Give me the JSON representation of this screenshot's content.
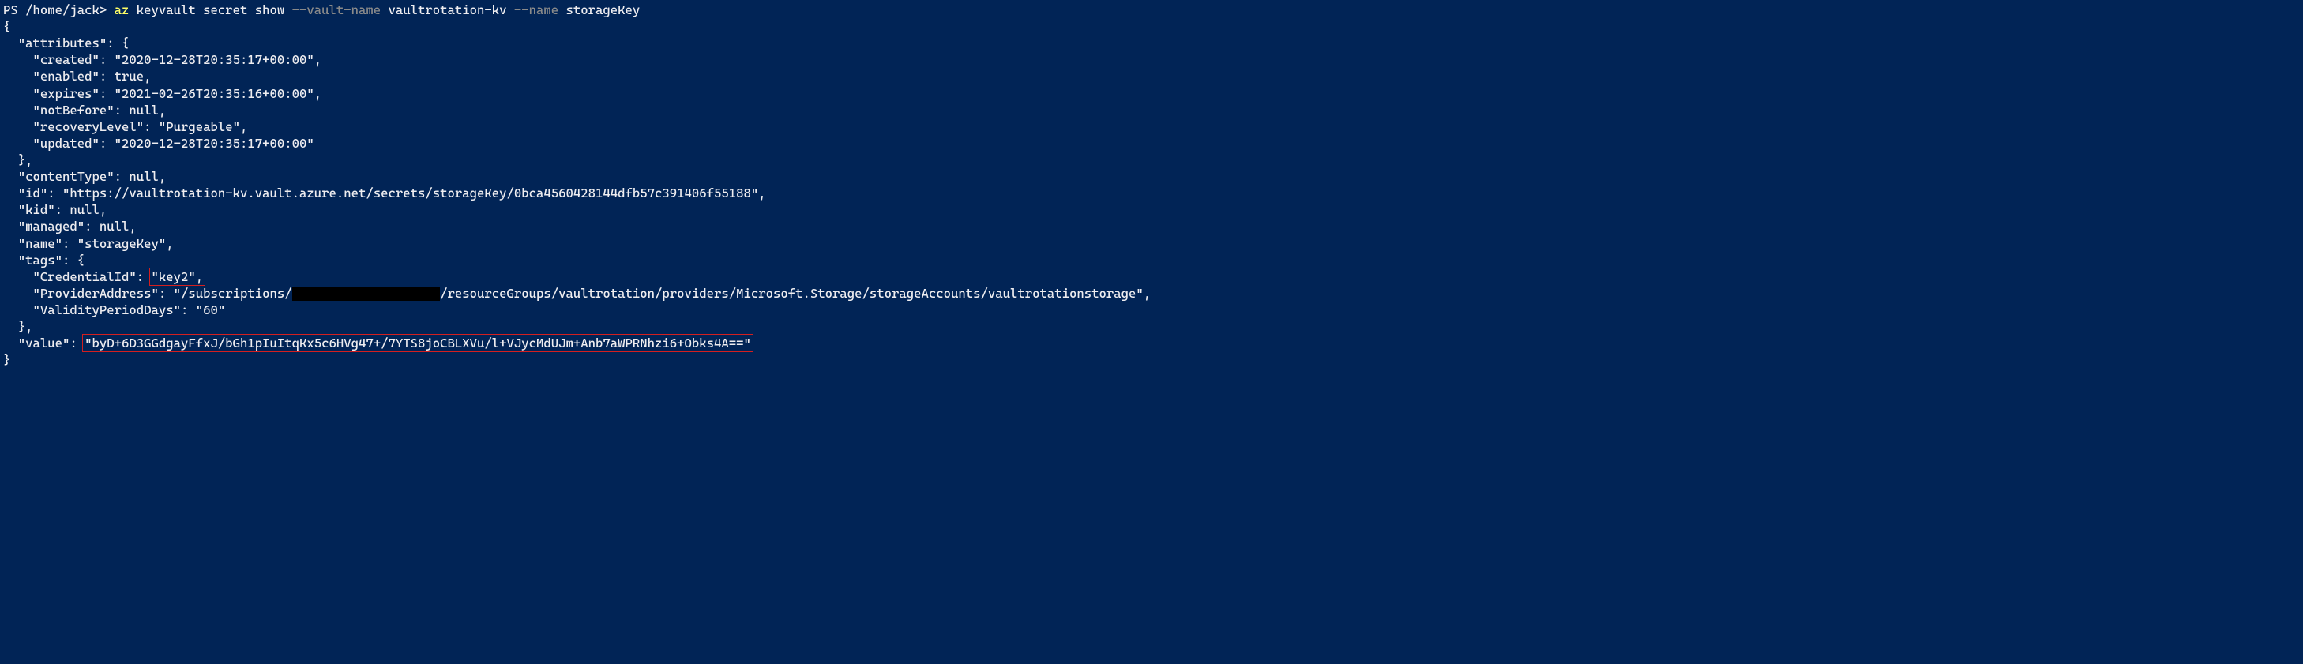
{
  "prompt": "PS /home/jack> ",
  "cmd": "az",
  "sub": " keyvault secret show ",
  "arg1": "--vault-name",
  "arg1v": " vaultrotation-kv ",
  "arg2": "--name",
  "arg2v": " storageKey",
  "l_open": "{",
  "l_attr": "  \"attributes\": {",
  "l_created": "    \"created\": \"2020-12-28T20:35:17+00:00\",",
  "l_enabled": "    \"enabled\": true,",
  "l_expires": "    \"expires\": \"2021-02-26T20:35:16+00:00\",",
  "l_notbefore": "    \"notBefore\": null,",
  "l_recovery": "    \"recoveryLevel\": \"Purgeable\",",
  "l_updated": "    \"updated\": \"2020-12-28T20:35:17+00:00\"",
  "l_attr_close": "  },",
  "l_contenttype": "  \"contentType\": null,",
  "l_id": "  \"id\": \"https://vaultrotation-kv.vault.azure.net/secrets/storageKey/0bca4560428144dfb57c391406f55188\",",
  "l_kid": "  \"kid\": null,",
  "l_managed": "  \"managed\": null,",
  "l_name": "  \"name\": \"storageKey\",",
  "l_tags": "  \"tags\": {",
  "l_cred_pre": "    \"CredentialId\": ",
  "l_cred_val": "\"key2\",",
  "l_prov_pre": "    \"ProviderAddress\": \"/subscriptions/",
  "l_prov_post": "/resourceGroups/vaultrotation/providers/Microsoft.Storage/storageAccounts/vaultrotationstorage\",",
  "l_validity": "    \"ValidityPeriodDays\": \"60\"",
  "l_tags_close": "  },",
  "l_value_pre": "  \"value\": ",
  "l_value_val": "\"byD+6D3GGdgayFfxJ/bGh1pIuItqKx5c6HVg47+/7YTS8joCBLXVu/l+VJycMdUJm+Anb7aWPRNhzi6+Obks4A==\"",
  "l_close": "}"
}
